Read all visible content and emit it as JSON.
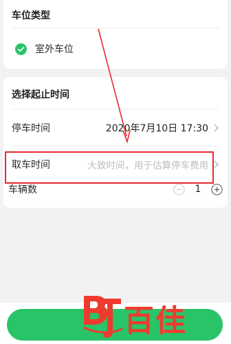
{
  "parking_type": {
    "title": "车位类型",
    "option_label": "室外车位",
    "option_selected": true
  },
  "time_section": {
    "title": "选择起止时间",
    "park_label": "停车时间",
    "park_value": "2020年7月10日 17:30",
    "pickup_label": "取车时间",
    "pickup_placeholder": "大致时间，用于估算停车费用"
  },
  "vehicles": {
    "label": "车辆数",
    "count": "1"
  },
  "watermark": {
    "logo_text": "百佳"
  },
  "colors": {
    "accent_green": "#29c468",
    "annotation_red": "#e42a2f"
  }
}
